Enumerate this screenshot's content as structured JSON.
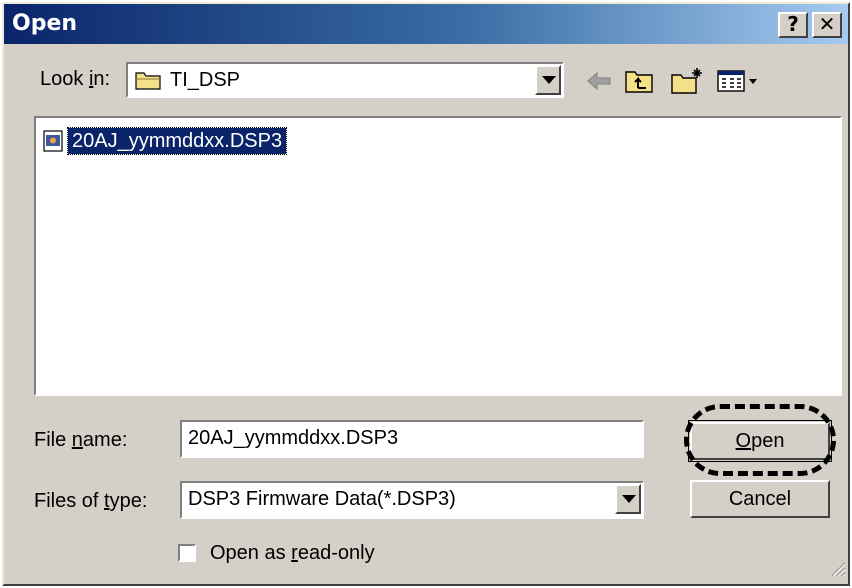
{
  "window": {
    "title": "Open",
    "help_label": "?",
    "close_label": "✕"
  },
  "lookin": {
    "label_pre": "Look ",
    "label_key": "i",
    "label_post": "n:",
    "value": "TI_DSP",
    "icons": [
      "folder-icon",
      "back-arrow-icon",
      "up-folder-icon",
      "new-folder-icon",
      "view-menu-icon"
    ]
  },
  "files": [
    {
      "name": "20AJ_yymmddxx.DSP3",
      "icon": "dsp-file-icon",
      "selected": true
    }
  ],
  "filename": {
    "label_pre": "File ",
    "label_key": "n",
    "label_post": "ame:",
    "value": "20AJ_yymmddxx.DSP3"
  },
  "filetype": {
    "label_pre": "Files of ",
    "label_key": "t",
    "label_post": "ype:",
    "value": "DSP3 Firmware Data(*.DSP3)"
  },
  "readonly": {
    "label_pre": "Open as ",
    "label_key": "r",
    "label_post": "ead-only",
    "checked": false
  },
  "buttons": {
    "open_key": "O",
    "open_rest": "pen",
    "cancel": "Cancel"
  },
  "colors": {
    "face": "#d4d0c8",
    "title_start": "#0a246a",
    "title_end": "#a6caf0",
    "selection": "#0a246a"
  }
}
